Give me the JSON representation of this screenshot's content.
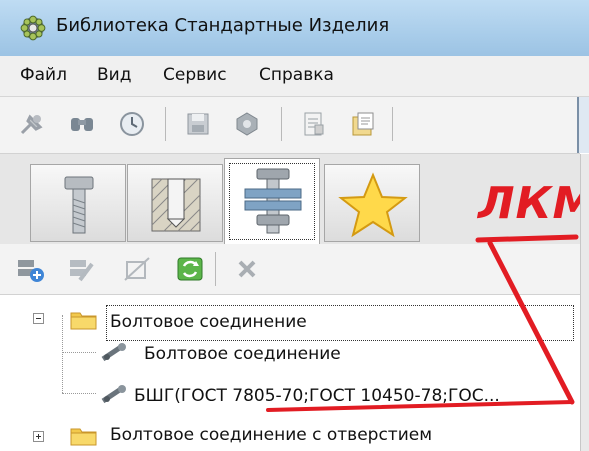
{
  "window": {
    "title": "Библиотека Стандартные Изделия"
  },
  "menu": {
    "items": [
      "Файл",
      "Вид",
      "Сервис",
      "Справка"
    ]
  },
  "toolbar": {
    "icons": [
      "pin-icon",
      "find-icon",
      "history-icon",
      "save-icon",
      "nut-icon",
      "properties-icon",
      "report-icon"
    ]
  },
  "tabs": [
    {
      "name": "bolt-tab",
      "icon": "bolt-icon"
    },
    {
      "name": "hole-tab",
      "icon": "hole-section-icon"
    },
    {
      "name": "connection-tab",
      "icon": "bolt-connection-icon"
    },
    {
      "name": "favorites-tab",
      "icon": "star-icon"
    }
  ],
  "annotation": {
    "text": "ЛКМ",
    "color": "#e21c23"
  },
  "subtoolbar": {
    "icons": [
      "add-connection-icon",
      "edit-connection-icon",
      "disable-icon",
      "refresh-icon",
      "delete-icon"
    ]
  },
  "tree": {
    "nodes": [
      {
        "label": "Болтовое соединение",
        "type": "folder",
        "expanded": true
      },
      {
        "label": "Болтовое соединение",
        "type": "item"
      },
      {
        "label": "БШГ(ГОСТ 7805-70;ГОСТ 10450-78;ГОС...",
        "type": "item"
      },
      {
        "label": "Болтовое соединение с отверстием",
        "type": "folder",
        "expanded": false
      }
    ]
  }
}
